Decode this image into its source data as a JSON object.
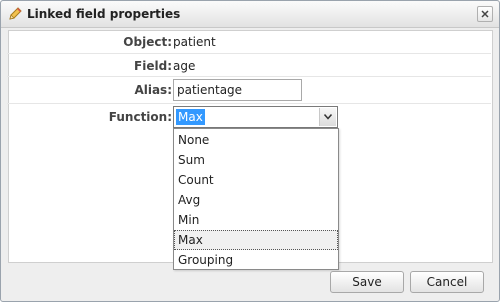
{
  "dialog": {
    "title": "Linked field properties",
    "title_icon": "pencil-icon",
    "close_icon": "close-icon"
  },
  "form": {
    "object": {
      "label": "Object:",
      "value": "patient"
    },
    "field": {
      "label": "Field:",
      "value": "age"
    },
    "alias": {
      "label": "Alias:",
      "value": "patientage"
    },
    "function": {
      "label": "Function:",
      "selected": "Max",
      "options": [
        "None",
        "Sum",
        "Count",
        "Avg",
        "Min",
        "Max",
        "Grouping"
      ]
    }
  },
  "buttons": {
    "save": "Save",
    "cancel": "Cancel"
  }
}
